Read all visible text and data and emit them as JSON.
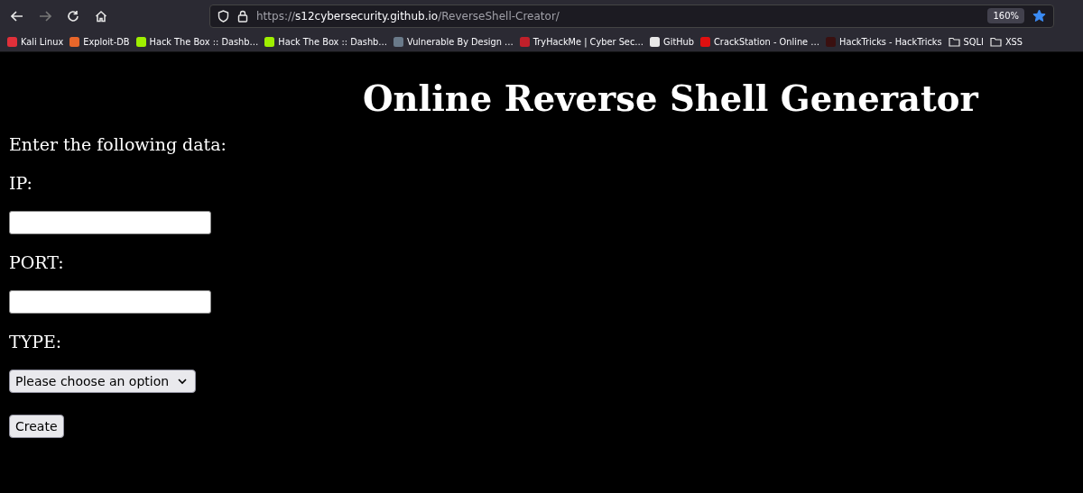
{
  "browser": {
    "url": {
      "scheme": "https://",
      "host": "s12cybersecurity.github.io",
      "path": "/ReverseShell-Creator/"
    },
    "zoom": "160%",
    "bookmarked": true
  },
  "bookmarks": [
    {
      "label": "Kali Linux",
      "kind": "site",
      "color": "#e0303a"
    },
    {
      "label": "Exploit-DB",
      "kind": "site",
      "color": "#e8662a"
    },
    {
      "label": "Hack The Box :: Dashb…",
      "kind": "site",
      "color": "#9fef00"
    },
    {
      "label": "Hack The Box :: Dashb…",
      "kind": "site",
      "color": "#9fef00"
    },
    {
      "label": "Vulnerable By Design …",
      "kind": "site",
      "color": "#6a7a8a"
    },
    {
      "label": "TryHackMe | Cyber Sec…",
      "kind": "site",
      "color": "#c0202a"
    },
    {
      "label": "GitHub",
      "kind": "site",
      "color": "#e8e8e8"
    },
    {
      "label": "CrackStation - Online …",
      "kind": "site",
      "color": "#e01010"
    },
    {
      "label": "HackTricks - HackTricks",
      "kind": "site",
      "color": "#3a1010"
    },
    {
      "label": "SQLI",
      "kind": "folder"
    },
    {
      "label": "XSS",
      "kind": "folder"
    }
  ],
  "page": {
    "title": "Online Reverse Shell Generator",
    "intro": "Enter the following data:",
    "fields": [
      {
        "label": "IP:",
        "kind": "text"
      },
      {
        "label": "PORT:",
        "kind": "text"
      },
      {
        "label": "TYPE:",
        "kind": "select",
        "value": "Please choose an option"
      }
    ],
    "submit": "Create"
  }
}
